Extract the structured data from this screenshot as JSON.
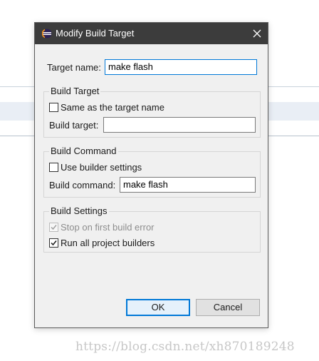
{
  "dialog": {
    "title": "Modify Build Target",
    "close_icon": "close-icon",
    "app_icon": "eclipse-icon",
    "target_name": {
      "label": "Target name:",
      "value": "make flash"
    },
    "build_target_group": {
      "title": "Build Target",
      "same_as_target": {
        "label": "Same as the target name",
        "checked": false
      },
      "build_target": {
        "label": "Build target:",
        "value": ""
      }
    },
    "build_command_group": {
      "title": "Build Command",
      "use_builder_settings": {
        "label": "Use builder settings",
        "checked": false
      },
      "build_command": {
        "label": "Build command:",
        "value": "make flash"
      }
    },
    "build_settings_group": {
      "title": "Build Settings",
      "stop_on_first_error": {
        "label": "Stop on first build error",
        "checked": true,
        "enabled": false
      },
      "run_all_builders": {
        "label": "Run all project builders",
        "checked": true,
        "enabled": true
      }
    },
    "buttons": {
      "ok": "OK",
      "cancel": "Cancel"
    },
    "colors": {
      "titlebar": "#3c3c3c",
      "accent": "#0078d7",
      "background": "#f0f0f0"
    }
  },
  "watermark": "https://blog.csdn.net/xh870189248"
}
